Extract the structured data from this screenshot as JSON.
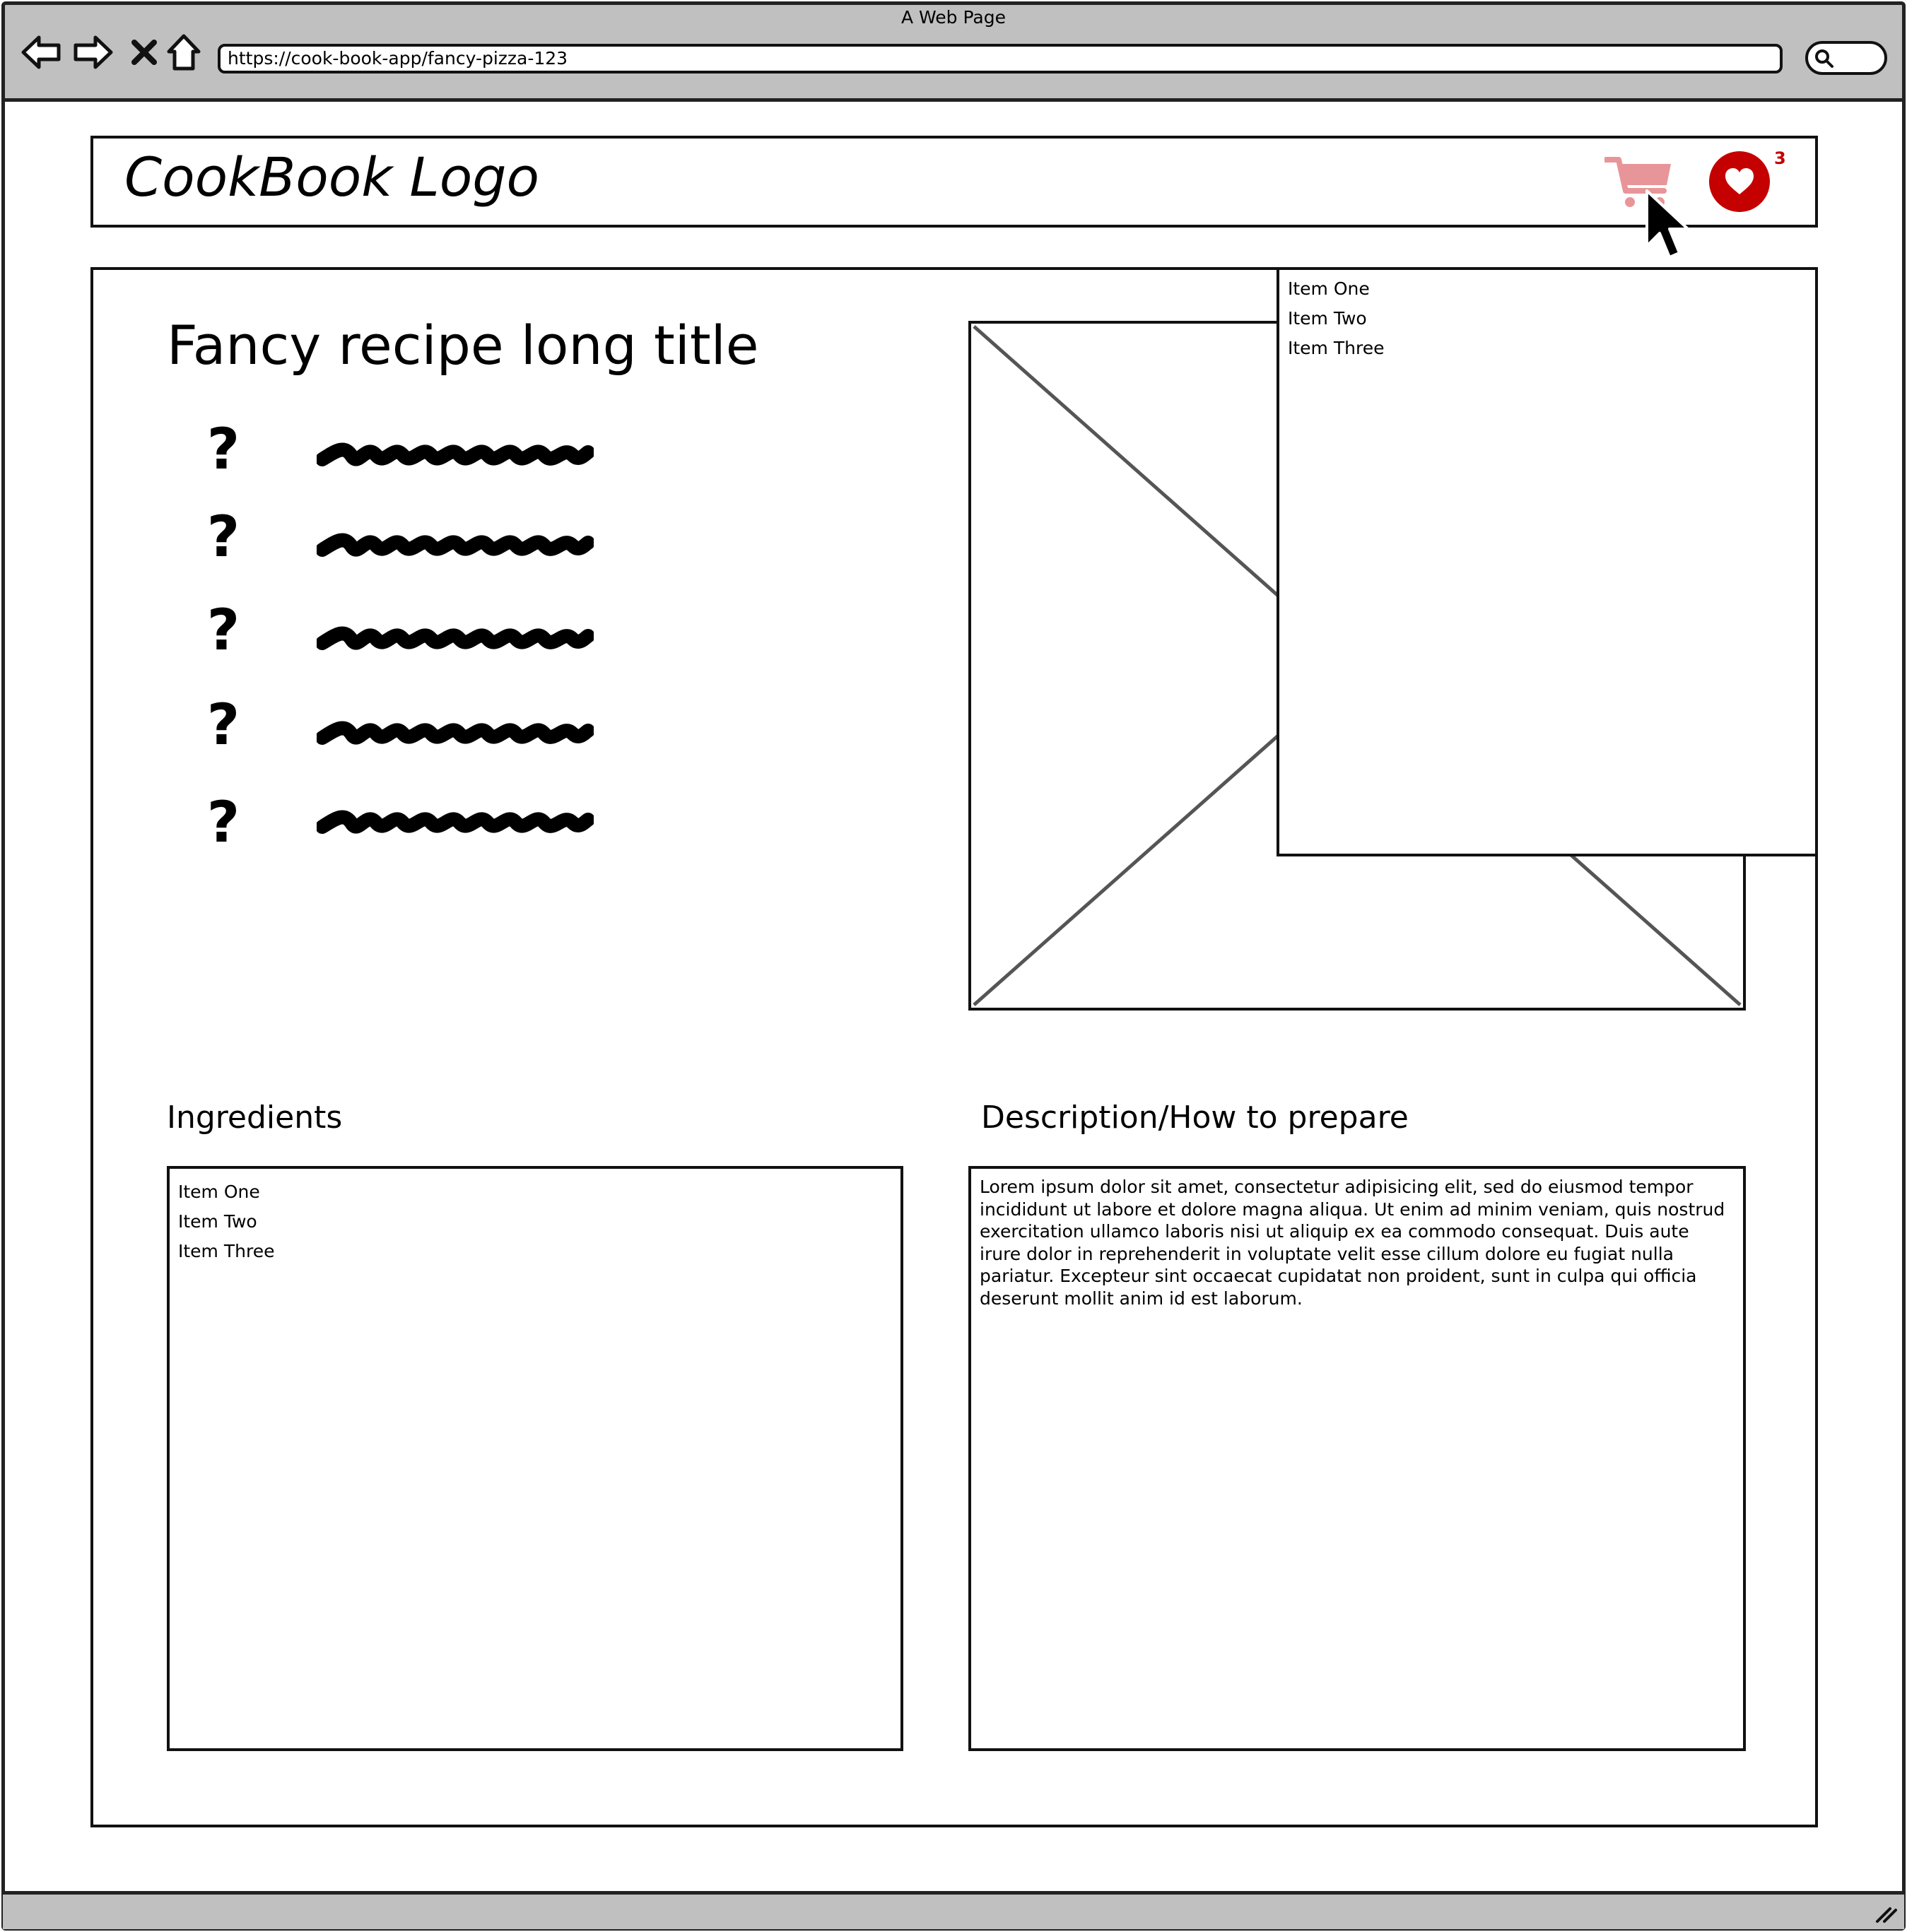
{
  "browser": {
    "window_title": "A Web Page",
    "url": "https://cook-book-app/fancy-pizza-123"
  },
  "header": {
    "logo": "CookBook Logo",
    "favorites_count": "3"
  },
  "recipe": {
    "title": "Fancy recipe long title",
    "meta_rows": [
      {
        "icon": "?"
      },
      {
        "icon": "?"
      },
      {
        "icon": "?"
      },
      {
        "icon": "?"
      },
      {
        "icon": "?"
      }
    ]
  },
  "cart_dropdown": {
    "items": [
      "Item One",
      "Item Two",
      "Item Three"
    ]
  },
  "ingredients": {
    "heading": "Ingredients",
    "items": [
      "Item One",
      "Item Two",
      "Item Three"
    ]
  },
  "description": {
    "heading": "Description/How to prepare",
    "text": "Lorem ipsum dolor sit amet, consectetur adipisicing elit, sed do eiusmod tempor incididunt ut labore et dolore magna aliqua. Ut enim ad minim veniam, quis nostrud exercitation ullamco laboris nisi ut aliquip ex ea commodo consequat. Duis aute irure dolor in reprehenderit in voluptate velit esse cillum dolore eu fugiat nulla pariatur. Excepteur sint occaecat cupidatat non proident, sunt in culpa qui officia deserunt mollit anim id est laborum."
  },
  "colors": {
    "cart_icon": "#e8959a",
    "favorite": "#c40000",
    "chrome": "#c0c0c0"
  }
}
